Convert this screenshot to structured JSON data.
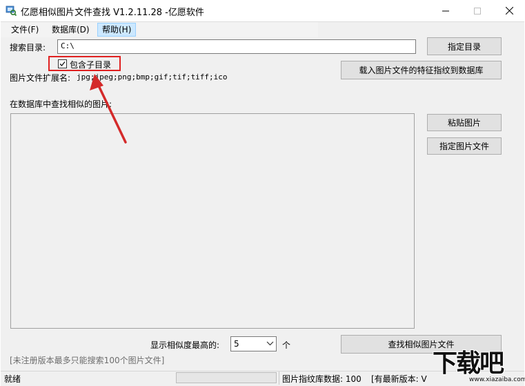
{
  "window": {
    "title": "亿愿相似图片文件查找 V1.2.11.28 -亿愿软件"
  },
  "menu": {
    "file": "文件(F)",
    "database": "数据库(D)",
    "help": "帮助(H)"
  },
  "search": {
    "dir_label": "搜索目录:",
    "dir_value": "C:\\",
    "specify_dir_button": "指定目录",
    "include_subdirs_label": "包含子目录",
    "include_subdirs_checked": true,
    "load_fingerprint_button": "载入图片文件的特征指纹到数据库",
    "ext_label": "图片文件扩展名:",
    "ext_value": "jpg;jpeg;png;bmp;gif;tif;tiff;ico"
  },
  "find": {
    "label": "在数据库中查找相似的图片:",
    "paste_button": "粘贴图片",
    "specify_file_button": "指定图片文件",
    "similar_label": "显示相似度最高的:",
    "similar_count": "5",
    "unit": "个",
    "find_button": "查找相似图片文件",
    "unregistered_note": "[未注册版本最多只能搜索100个图片文件]"
  },
  "status": {
    "ready": "就绪",
    "fingerprint_count": "图片指纹库数据: 100",
    "latest_version": "[有最新版本: V"
  },
  "watermark": {
    "logo": "下载吧",
    "url": "www.xiazaiba.com"
  },
  "colors": {
    "highlight": "#e02020",
    "menu_active_bg": "#cce8ff",
    "arrow": "#d42a2a"
  }
}
